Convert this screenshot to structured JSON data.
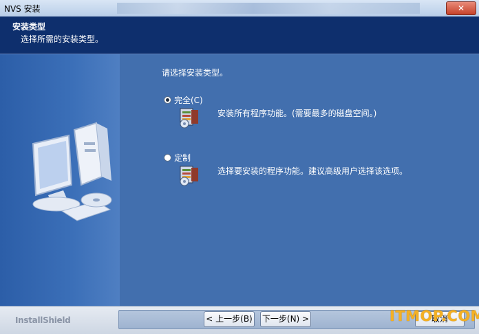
{
  "window": {
    "title": "NVS 安装",
    "close_label": "✕"
  },
  "header": {
    "title": "安装类型",
    "subtitle": "选择所需的安装类型。"
  },
  "main": {
    "prompt": "请选择安装类型。",
    "options": [
      {
        "label": "完全(C)",
        "selected": true,
        "description": "安装所有程序功能。(需要最多的磁盘空间。)"
      },
      {
        "label": "定制",
        "selected": false,
        "description": "选择要安装的程序功能。建议高级用户选择该选项。"
      }
    ]
  },
  "footer": {
    "brand": "InstallShield",
    "back_label": "< 上一步(B)",
    "next_label": "下一步(N) >",
    "cancel_label": "取消"
  },
  "watermark": "ITMOP.COM",
  "colors": {
    "header_bg": "#0e2f6d",
    "panel_bg": "#426fae",
    "watermark": "#f4b024"
  }
}
